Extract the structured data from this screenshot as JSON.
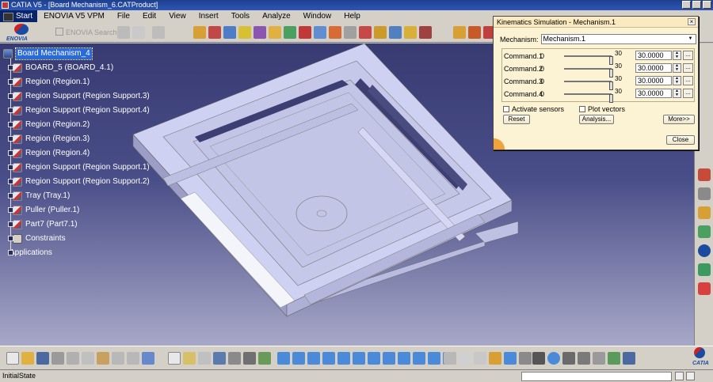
{
  "window": {
    "title": "CATIA V5 - [Board Mechanism_6.CATProduct]"
  },
  "menu": {
    "items": [
      "Start",
      "ENOVIA V5 VPM",
      "File",
      "Edit",
      "View",
      "Insert",
      "Tools",
      "Analyze",
      "Window",
      "Help"
    ]
  },
  "toolbar": {
    "enovia_label": "ENOVIA",
    "search_placeholder": "ENOVIA Search..."
  },
  "tree": {
    "items": [
      "Board Mechanism_4",
      "BOARD_5 (BOARD_4.1)",
      "Region (Region.1)",
      "Region Support (Region Support.3)",
      "Region Support (Region Support.4)",
      "Region (Region.2)",
      "Region (Region.3)",
      "Region (Region.4)",
      "Region Support (Region Support.1)",
      "Region Support (Region Support.2)",
      "Tray (Tray.1)",
      "Puller (Puller.1)",
      "Part7 (Part7.1)",
      "Constraints",
      "Applications"
    ]
  },
  "dialog": {
    "title": "Kinematics Simulation - Mechanism.1",
    "mechanism_label": "Mechanism:",
    "mechanism_value": "Mechanism.1",
    "commands": [
      {
        "name": "Command.1",
        "min": "0",
        "max": "30",
        "value": "30.0000",
        "fraction": 1.0
      },
      {
        "name": "Command.2",
        "min": "0",
        "max": "30",
        "value": "30.0000",
        "fraction": 1.0
      },
      {
        "name": "Command.3",
        "min": "0",
        "max": "30",
        "value": "30.0000",
        "fraction": 1.0
      },
      {
        "name": "Command.4",
        "min": "0",
        "max": "30",
        "value": "30.0000",
        "fraction": 1.0
      }
    ],
    "activate_sensors": "Activate sensors",
    "plot_vectors": "Plot vectors",
    "reset": "Reset",
    "analysis": "Analysis...",
    "more": "More>>",
    "close": "Close"
  },
  "status": {
    "message": "InitialState"
  },
  "brand": {
    "catia": "CATIA"
  }
}
